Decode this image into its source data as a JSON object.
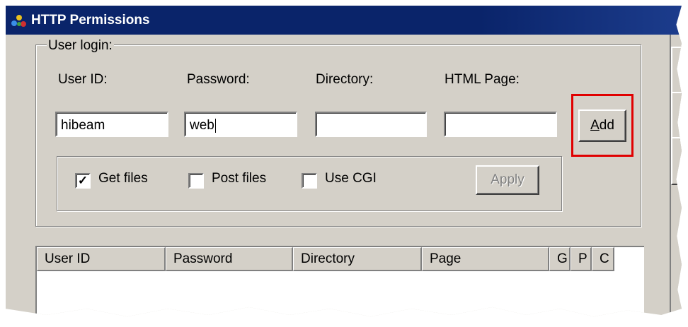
{
  "window": {
    "title": "HTTP Permissions"
  },
  "user_login": {
    "group_label": "User login:",
    "user_id_label": "User ID:",
    "user_id_value": "hibeam",
    "password_label": "Password:",
    "password_value": "web",
    "directory_label": "Directory:",
    "directory_value": "",
    "html_page_label": "HTML Page:",
    "html_page_value": "",
    "add_label_accel": "A",
    "add_label_rest": "dd"
  },
  "options": {
    "get_files": {
      "label": "Get files",
      "checked": true
    },
    "post_files": {
      "label": "Post files",
      "checked": false
    },
    "use_cgi": {
      "label": "Use CGI",
      "checked": false
    },
    "apply_label": "Apply"
  },
  "list": {
    "columns": [
      "User ID",
      "Password",
      "Directory",
      "Page",
      "G",
      "P",
      "C"
    ]
  },
  "colors": {
    "highlight": "#e00000",
    "titlebar": "#0a246a",
    "face": "#d4d0c8"
  }
}
